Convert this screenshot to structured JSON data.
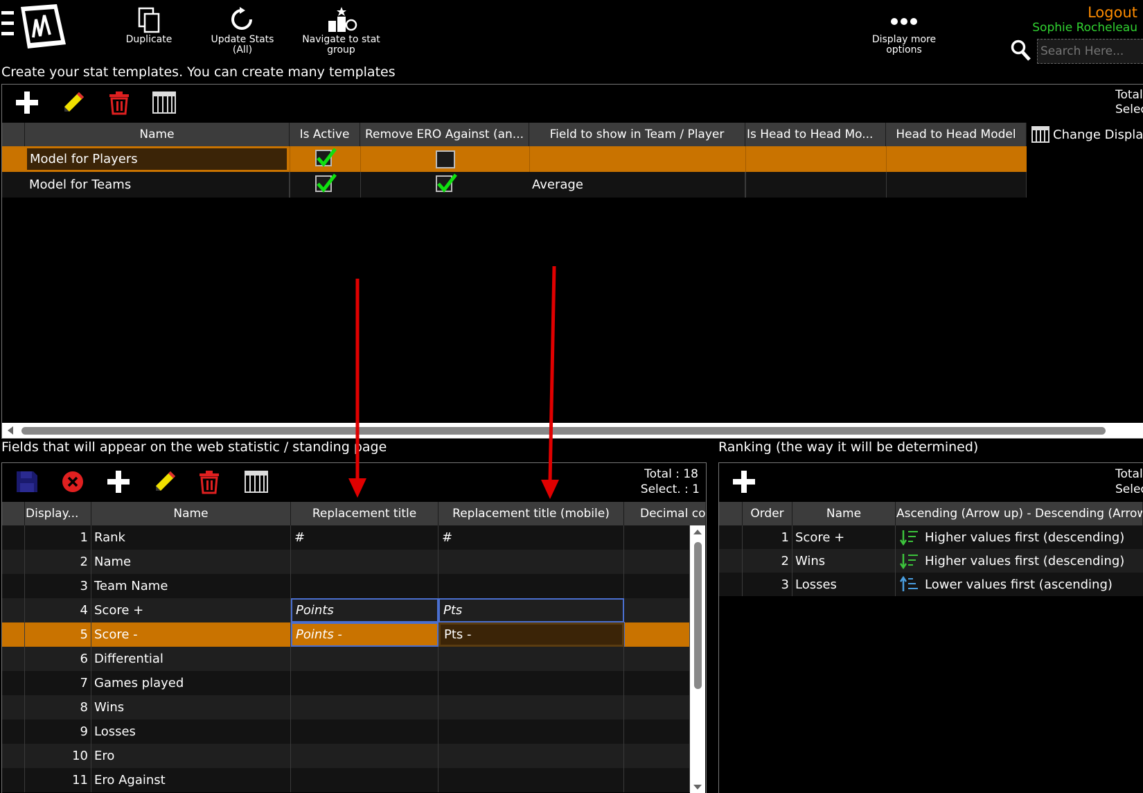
{
  "toolbar": {
    "duplicate_label": "Duplicate",
    "update_stats_label_1": "Update Stats",
    "update_stats_label_2": "(All)",
    "navigate_label_1": "Navigate to stat",
    "navigate_label_2": "group",
    "more_options_label_1": "Display more",
    "more_options_label_2": "options"
  },
  "user": {
    "logout_label": "Logout",
    "user_name": "Sophie Rocheleau",
    "search_placeholder": "Search Here..."
  },
  "templates": {
    "section_title": "Create your stat templates. You can create many templates",
    "total_label": "Total",
    "select_label": "Selec",
    "change_display_label": "Change Display",
    "columns": [
      "Name",
      "Is Active",
      "Remove ERO Against (an...",
      "Field to show in Team / Player",
      "Is Head to Head Mo...",
      "Head to Head Model"
    ],
    "rows": [
      {
        "name": "Model for Players",
        "is_active": true,
        "remove_ero": false,
        "field_to_show": "",
        "selected": true
      },
      {
        "name": "Model for Teams",
        "is_active": true,
        "remove_ero": true,
        "field_to_show": "Average",
        "selected": false
      }
    ]
  },
  "fields": {
    "section_title": "Fields that will appear on the web statistic / standing page",
    "total_text": "Total : 18",
    "select_text": "Select. : 1",
    "columns": [
      "Display...",
      "Name",
      "Replacement title",
      "Replacement title (mobile)",
      "Decimal co"
    ],
    "rows": [
      {
        "order": "1",
        "name": "Rank",
        "title": "#",
        "mobile": "#"
      },
      {
        "order": "2",
        "name": "Name",
        "title": "",
        "mobile": ""
      },
      {
        "order": "3",
        "name": "Team Name",
        "title": "",
        "mobile": ""
      },
      {
        "order": "4",
        "name": "Score +",
        "title": "Points",
        "mobile": "Pts"
      },
      {
        "order": "5",
        "name": "Score -",
        "title": "Points -",
        "mobile": "Pts -"
      },
      {
        "order": "6",
        "name": "Differential",
        "title": "",
        "mobile": ""
      },
      {
        "order": "7",
        "name": "Games played",
        "title": "",
        "mobile": ""
      },
      {
        "order": "8",
        "name": "Wins",
        "title": "",
        "mobile": ""
      },
      {
        "order": "9",
        "name": "Losses",
        "title": "",
        "mobile": ""
      },
      {
        "order": "10",
        "name": "Ero",
        "title": "",
        "mobile": ""
      },
      {
        "order": "11",
        "name": "Ero Against",
        "title": "",
        "mobile": ""
      }
    ]
  },
  "ranking": {
    "section_title": "Ranking (the way it will be determined)",
    "total_label": "Total",
    "select_label": "Selec",
    "columns": [
      "Order",
      "Name",
      "Ascending (Arrow up) - Descending (Arrow"
    ],
    "rows": [
      {
        "order": "1",
        "name": "Score +",
        "direction": "Higher values first (descending)",
        "icon": "sort-descending-icon"
      },
      {
        "order": "2",
        "name": "Wins",
        "direction": "Higher values first (descending)",
        "icon": "sort-descending-icon"
      },
      {
        "order": "3",
        "name": "Losses",
        "direction": "Lower values first (ascending)",
        "icon": "sort-ascending-icon"
      }
    ]
  },
  "colors": {
    "selection": "#c97300",
    "logout": "#ff8c00",
    "username": "#31d331",
    "annotation_arrow": "#e00000"
  }
}
